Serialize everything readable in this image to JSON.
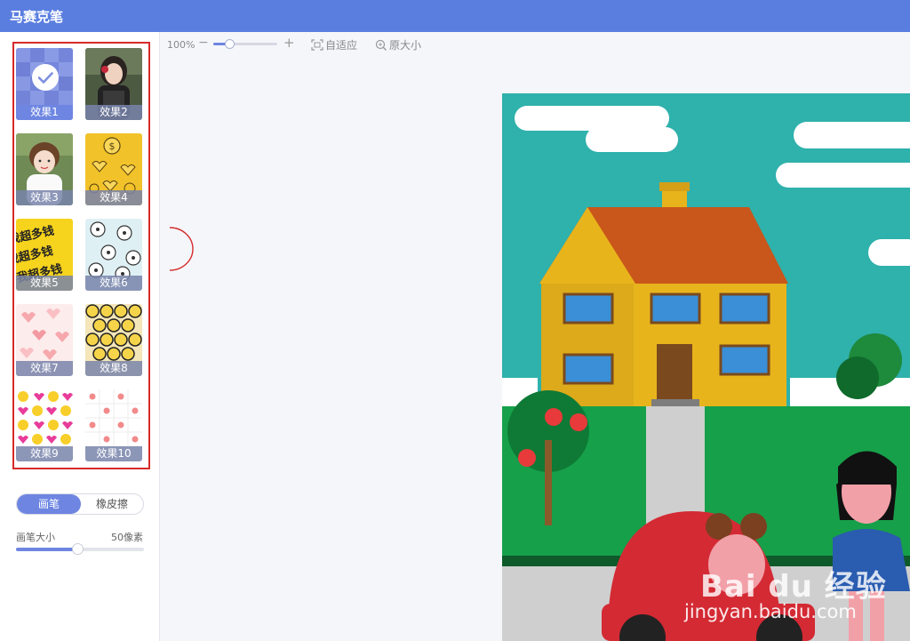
{
  "app": {
    "title": "马赛克笔"
  },
  "effects": [
    {
      "label": "效果1",
      "selected": true
    },
    {
      "label": "效果2",
      "selected": false
    },
    {
      "label": "效果3",
      "selected": false
    },
    {
      "label": "效果4",
      "selected": false
    },
    {
      "label": "效果5",
      "selected": false
    },
    {
      "label": "效果6",
      "selected": false
    },
    {
      "label": "效果7",
      "selected": false
    },
    {
      "label": "效果8",
      "selected": false
    },
    {
      "label": "效果9",
      "selected": false
    },
    {
      "label": "效果10",
      "selected": false
    }
  ],
  "effect_thumb_texts": {
    "effect5_pattern": "我超多钱"
  },
  "mode": {
    "brush_label": "画笔",
    "eraser_label": "橡皮擦",
    "active": "brush"
  },
  "brush_size": {
    "label": "画笔大小",
    "value_text": "50像素",
    "fraction": 0.48
  },
  "toolbar": {
    "zoom_text": "100%",
    "zoom_minus": "−",
    "zoom_plus": "+",
    "zoom_fraction": 0.25,
    "fit_label": "自适应",
    "original_label": "原大小"
  },
  "watermark": {
    "brand": "Bai du 经验",
    "url": "jingyan.baidu.com"
  },
  "colors": {
    "accent": "#6e86e2",
    "titlebar": "#5a7ee0",
    "selection_border": "#d62a2a"
  },
  "icons": {
    "check": "check-icon",
    "fit": "fit-icon",
    "original": "zoom-icon"
  }
}
